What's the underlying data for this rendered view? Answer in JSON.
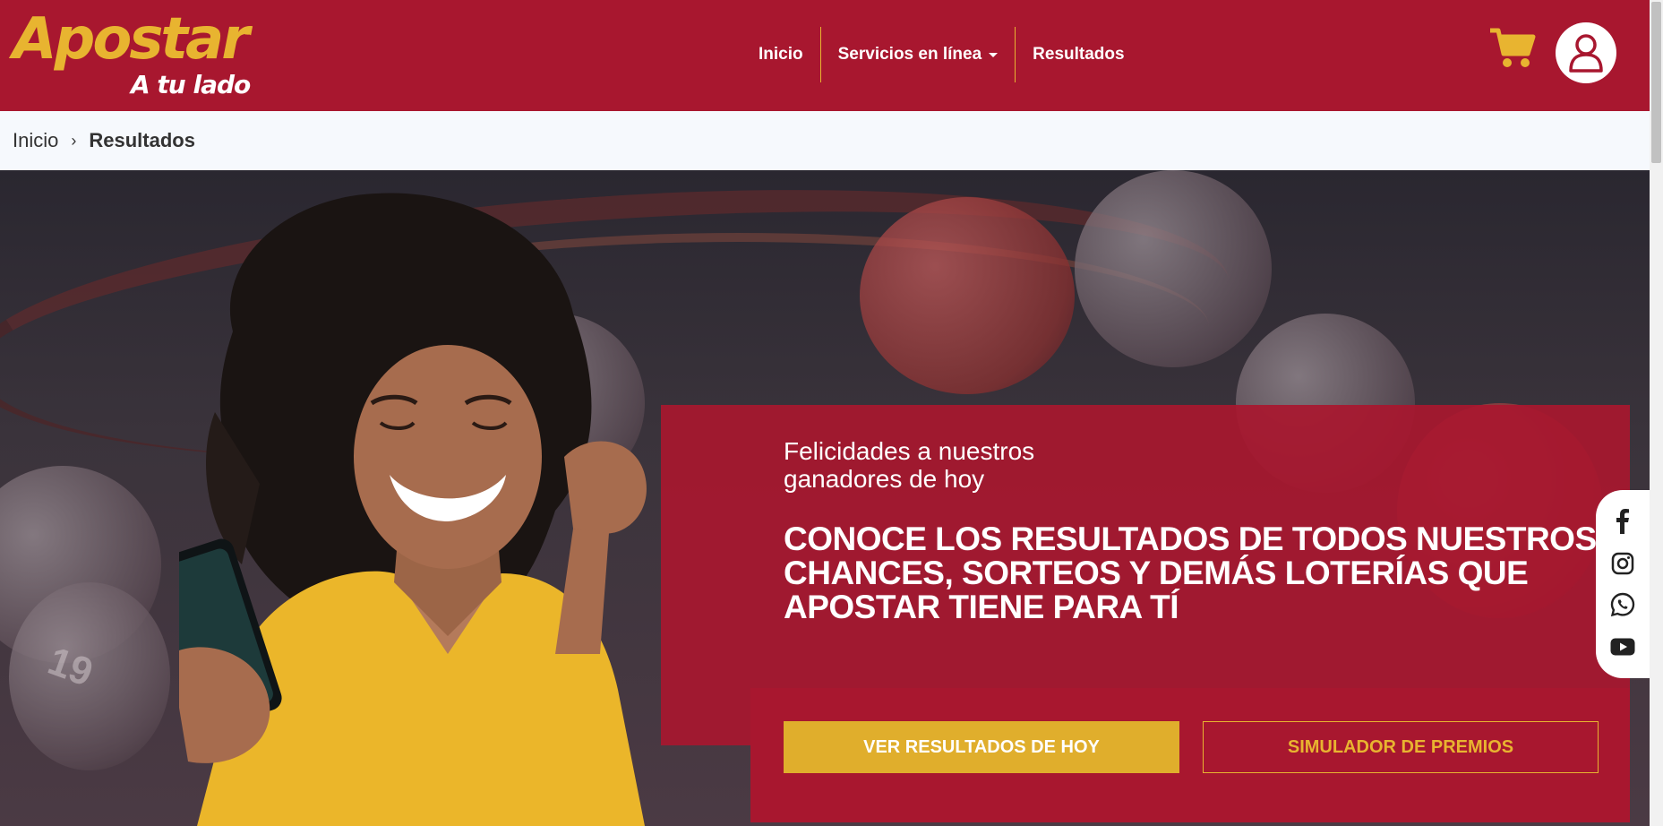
{
  "brand": {
    "name": "Apostar",
    "tagline": "A tu lado",
    "reg": "®"
  },
  "nav": {
    "items": [
      {
        "label": "Inicio"
      },
      {
        "label": "Servicios en línea",
        "has_dropdown": true
      },
      {
        "label": "Resultados"
      }
    ]
  },
  "header_icons": {
    "cart": "shopping-cart-icon",
    "user": "user-icon"
  },
  "breadcrumb": {
    "home": "Inicio",
    "separator": "›",
    "current": "Resultados"
  },
  "hero": {
    "subtitle": "Felicidades a nuestros ganadores de hoy",
    "headline": "CONOCE LOS RESULTADOS DE TODOS NUESTROS CHANCES, SORTEOS Y DEMÁS LOTERÍAS QUE APOSTAR TIENE PARA TÍ",
    "primary_button": "VER RESULTADOS DE HOY",
    "secondary_button": "SIMULADOR DE PREMIOS",
    "ball_numbers": [
      "19"
    ]
  },
  "social": [
    "facebook-icon",
    "instagram-icon",
    "whatsapp-icon",
    "youtube-icon"
  ],
  "colors": {
    "brand_red": "#a8172f",
    "brand_gold": "#e8b430",
    "button_gold": "#e0ae2c",
    "breadcrumb_bg": "#f6f9fd"
  }
}
